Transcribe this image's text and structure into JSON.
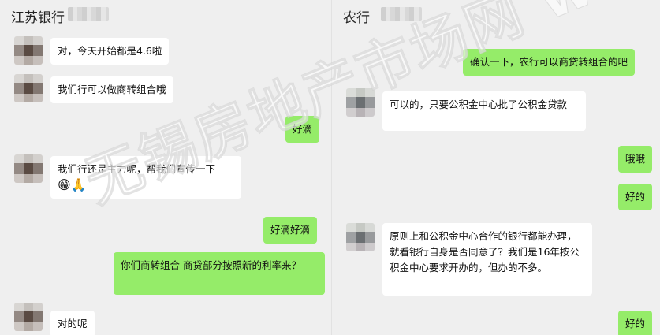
{
  "left_chat": {
    "title": "江苏银行",
    "messages": [
      {
        "from": "them",
        "text": "对，今天开始都是4.6啦"
      },
      {
        "from": "them",
        "text": "我们行可以做商转组合哦"
      },
      {
        "from": "me",
        "text": "好滴"
      },
      {
        "from": "them",
        "text": "我们行还是主力呢，帮我们宣传一下"
      },
      {
        "from": "me",
        "text": "好滴好滴"
      },
      {
        "from": "me",
        "text": "你们商转组合  商贷部分按照新的利率来？"
      },
      {
        "from": "them",
        "text": "对的呢"
      }
    ],
    "emoji": [
      "😁",
      "🙏"
    ]
  },
  "right_chat": {
    "title": "农行",
    "messages": [
      {
        "from": "me",
        "text": "确认一下，农行可以商贷转组合的吧"
      },
      {
        "from": "them",
        "text": "可以的，只要公积金中心批了公积金贷款"
      },
      {
        "from": "me",
        "text": "哦哦"
      },
      {
        "from": "me",
        "text": "好的"
      },
      {
        "from": "them",
        "text": "原则上和公积金中心合作的银行都能办理，就看银行自身是否同意了？我们是16年按公积金中心要求开办的，但办的不多。"
      },
      {
        "from": "me",
        "text": "好的"
      }
    ]
  },
  "watermark": "无锡房地产市场网 www.wxhouse.com",
  "colors": {
    "background": "#efefef",
    "incoming": "#ffffff",
    "outgoing": "#95ec69"
  }
}
